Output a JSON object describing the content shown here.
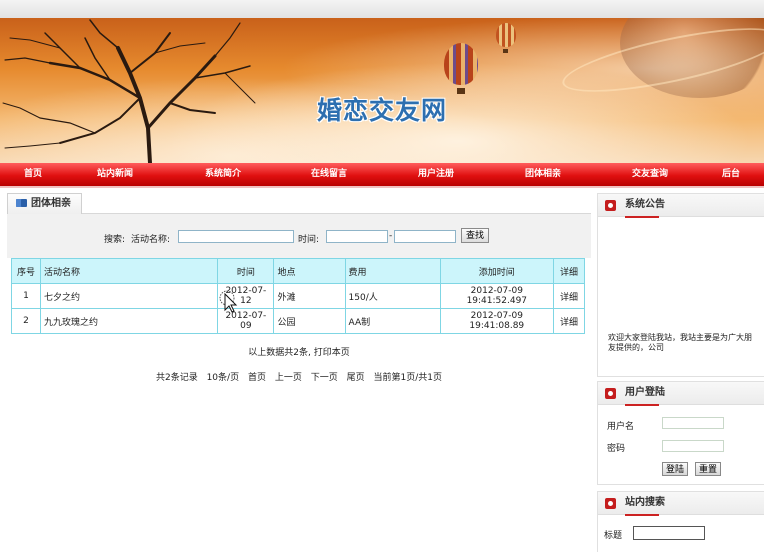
{
  "banner": {
    "title": "婚恋交友网"
  },
  "nav": {
    "items": [
      "首页",
      "站内新闻",
      "系统简介",
      "在线留言",
      "用户注册",
      "团体相亲",
      "交友查询",
      "后台"
    ]
  },
  "breadcrumb": {
    "label": "团体相亲"
  },
  "search": {
    "label_prefix": "搜索:",
    "name_label": "活动名称:",
    "time_label": "时间:",
    "dash": "-",
    "button": "查找"
  },
  "table": {
    "headers": [
      "序号",
      "活动名称",
      "时间",
      "地点",
      "费用",
      "添加时间",
      "详细"
    ],
    "rows": [
      {
        "no": "1",
        "name": "七夕之约",
        "date": "2012-07-12",
        "place": "外滩",
        "fee": "150/人",
        "added": "2012-07-09 19:41:52.497",
        "detail": "详细"
      },
      {
        "no": "2",
        "name": "九九玫瑰之约",
        "date": "2012-07-09",
        "place": "公园",
        "fee": "AA制",
        "added": "2012-07-09 19:41:08.89",
        "detail": "详细"
      }
    ]
  },
  "summary": "以上数据共2条, 打印本页",
  "pager": {
    "total": "共2条记录",
    "per_page": "10条/页",
    "first": "首页",
    "prev": "上一页",
    "next": "下一页",
    "last": "尾页",
    "current": "当前第1页/共1页"
  },
  "notice": {
    "title": "系统公告",
    "text": "欢迎大家登陆我站，我站主要是为广大朋友提供的，公司"
  },
  "login": {
    "title": "用户登陆",
    "username_label": "用户名",
    "password_label": "密码",
    "login_button": "登陆",
    "reset_button": "重置"
  },
  "site_search": {
    "title": "站内搜索",
    "title_label": "标题"
  },
  "colors": {
    "nav_red": "#e01010",
    "table_border": "#7fd6e4",
    "table_head": "#ccf5fb",
    "banner_title": "#2d6fb0"
  }
}
